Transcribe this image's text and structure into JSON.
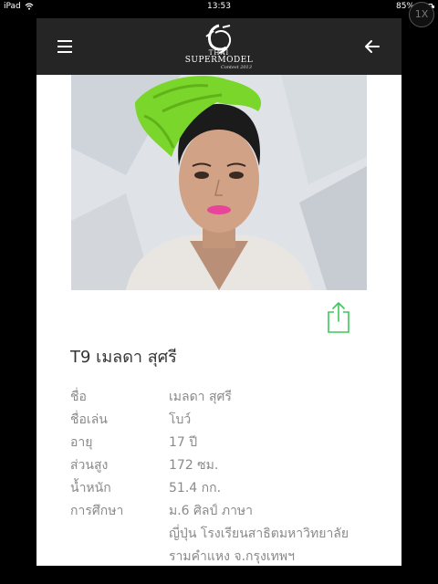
{
  "status": {
    "device": "iPad",
    "time": "13:53",
    "battery": "85%"
  },
  "zoom_label": "1X",
  "logo": {
    "line1": "THAI",
    "line2": "SUPERMODEL",
    "line3": "Contest 2013"
  },
  "model": {
    "title": "T9 เมลดา สุศรี",
    "fields": [
      {
        "label": "ชื่อ",
        "value": "เมลดา สุศรี"
      },
      {
        "label": "ชื่อเล่น",
        "value": "โบว์"
      },
      {
        "label": "อายุ",
        "value": "17 ปี"
      },
      {
        "label": "ส่วนสูง",
        "value": "172 ซม."
      },
      {
        "label": "น้ำหนัก",
        "value": "51.4 กก."
      },
      {
        "label": "การศึกษา",
        "value": "ม.6 ศิลป์ ภาษา"
      },
      {
        "label": "",
        "value": "ญี่ปุ่น โรงเรียนสาธิตมหาวิทยาลัย"
      },
      {
        "label": "",
        "value": "รามคำแหง จ.กรุงเทพฯ"
      }
    ]
  },
  "colors": {
    "header": "#252525",
    "accent": "#3ec75a",
    "hair": "#7ad62a",
    "lips": "#e8459a"
  }
}
